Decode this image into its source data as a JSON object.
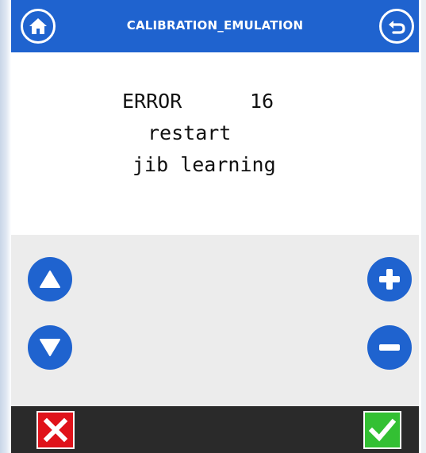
{
  "header": {
    "title": "CALIBRATION_EMULATION",
    "home_icon": "home-icon",
    "back_icon": "back-arrow-icon",
    "color": "#1f63cf"
  },
  "message": {
    "error_label": "ERROR",
    "error_code": "16",
    "line2": "restart",
    "line3": "jib learning"
  },
  "controls": {
    "up_icon": "arrow-up-icon",
    "down_icon": "arrow-down-icon",
    "plus_icon": "plus-icon",
    "minus_icon": "minus-icon",
    "color": "#1f63cf"
  },
  "footer": {
    "cancel_icon": "x-icon",
    "confirm_icon": "checkmark-icon",
    "cancel_color": "#e0121a",
    "confirm_color": "#33c033"
  }
}
